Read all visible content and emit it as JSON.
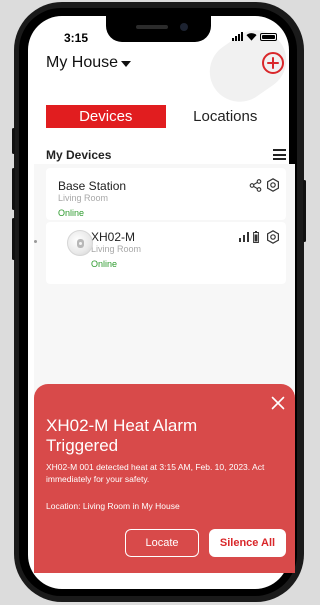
{
  "status_bar": {
    "time": "3:15"
  },
  "header": {
    "house_name": "My House"
  },
  "tabs": [
    {
      "label": "Devices",
      "active": true
    },
    {
      "label": "Locations",
      "active": false
    }
  ],
  "section": {
    "title": "My Devices"
  },
  "devices": [
    {
      "name": "Base Station",
      "room": "Living Room",
      "status": "Online"
    },
    {
      "name": "XH02-M",
      "room": "Living Room",
      "status": "Online"
    }
  ],
  "alert": {
    "title": "XH02-M Heat Alarm Triggered",
    "message": "XH02-M 001 detected heat at 3:15 AM, Feb. 10, 2023. Act immediately for your safety.",
    "location": "Location: Living Room in My House",
    "locate_label": "Locate",
    "silence_label": "Silence All"
  },
  "colors": {
    "accent": "#e11d1f",
    "alert_bg": "#d84a4a",
    "online": "#2e9b2e"
  },
  "icons": [
    "plus-circle-icon",
    "menu-icon",
    "share-icon",
    "settings-gear-icon",
    "signal-icon",
    "battery-icon",
    "close-icon",
    "caret-down-icon"
  ]
}
